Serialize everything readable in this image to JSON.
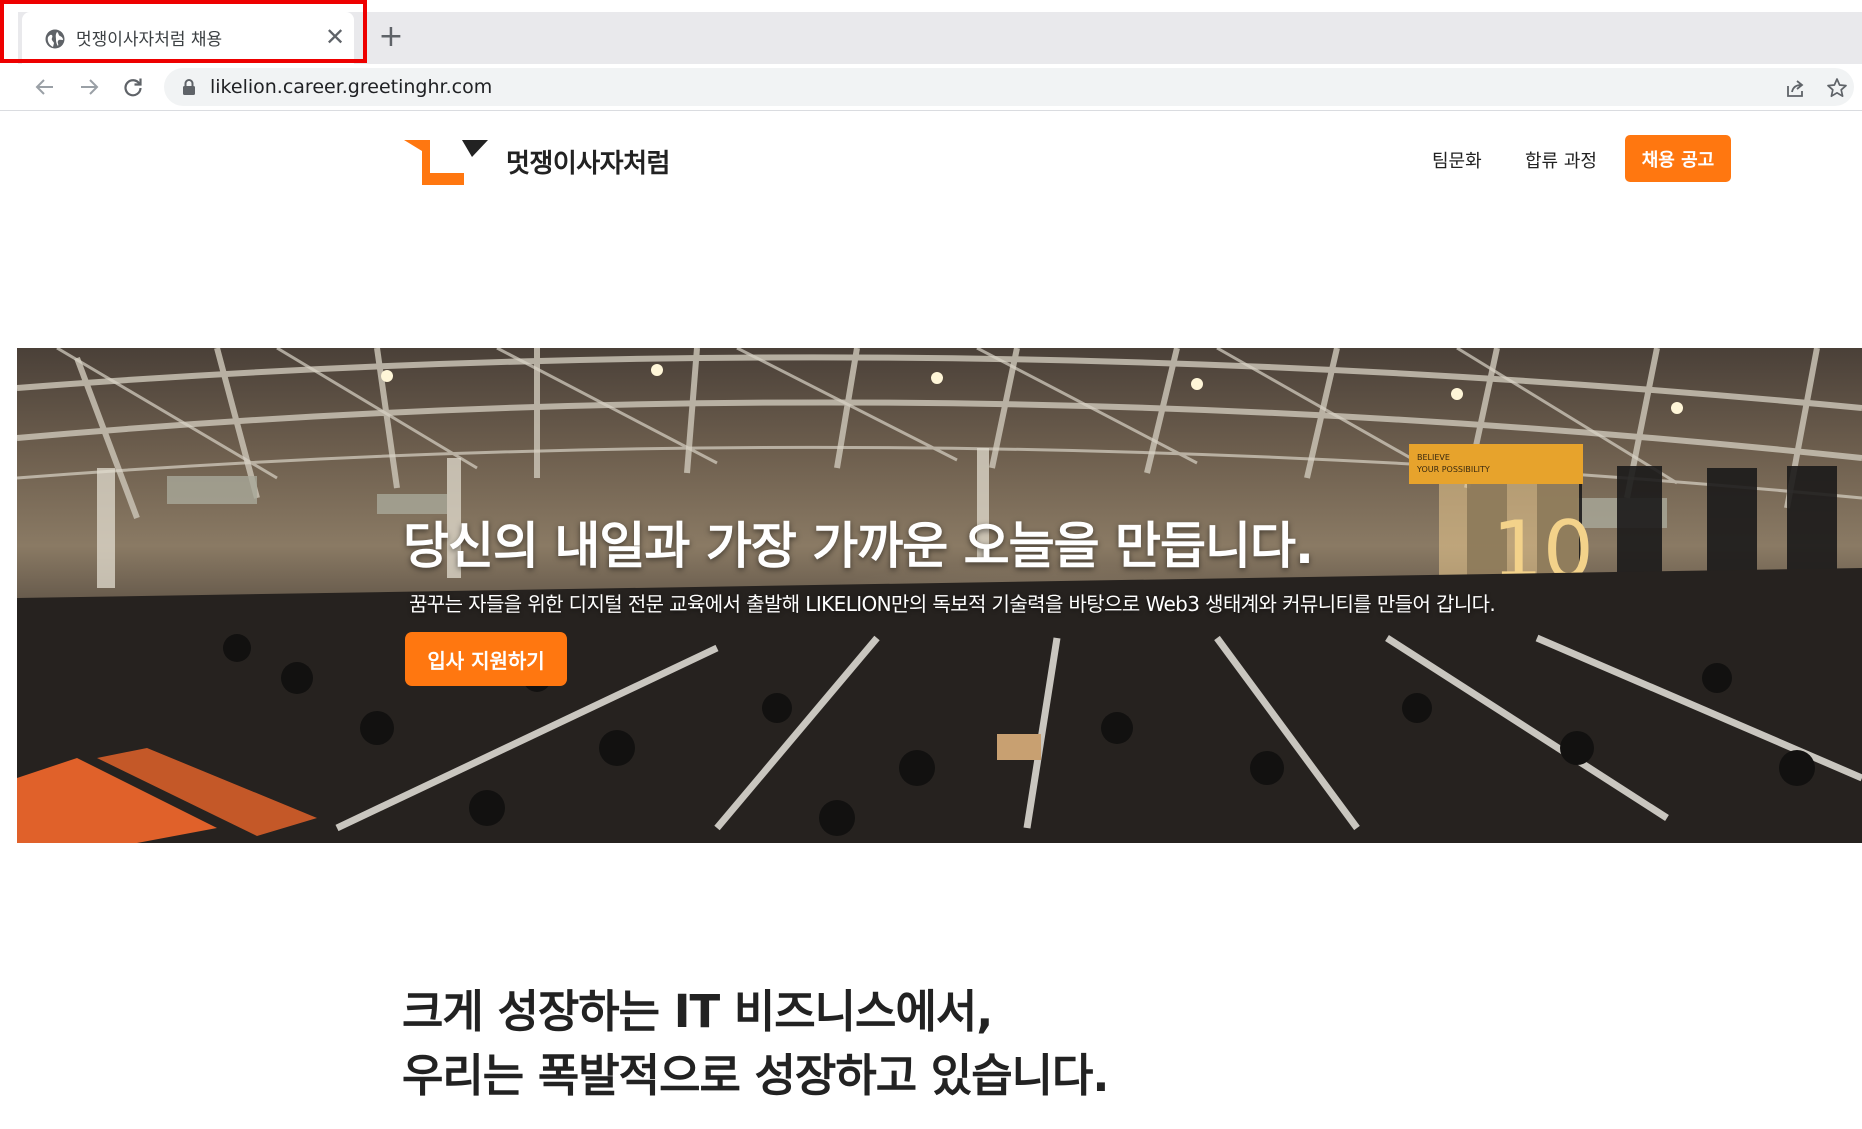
{
  "browser": {
    "tab": {
      "title": "멋쟁이사자처럼 채용",
      "close_glyph": "✕",
      "icon": "globe-icon"
    },
    "new_tab_glyph": "+",
    "toolbar": {
      "url": "likelion.career.greetinghr.com",
      "back_icon": "back-arrow-icon",
      "forward_icon": "forward-arrow-icon",
      "reload_icon": "reload-icon",
      "lock_icon": "lock-icon",
      "share_icon": "share-icon",
      "bookmark_icon": "star-icon"
    },
    "highlight_color": "#ee0000"
  },
  "site": {
    "brand": "멋쟁이사자처럼",
    "nav": [
      "팀문화",
      "합류 과정"
    ],
    "cta": "채용 공고",
    "accent": "#ff7710"
  },
  "hero": {
    "title": "당신의 내일과 가장 가까운 오늘을 만듭니다.",
    "subtitle": "꿈꾸는 자들을 위한 디지털 전문 교육에서 출발해 LIKELION만의 독보적 기술력을 바탕으로 Web3 생태계와 커뮤니티를 만들어 갑니다.",
    "button": "입사 지원하기",
    "banner": {
      "line1": "BELIEVE",
      "line2": "YOUR POSSIBILITY",
      "number": "10"
    }
  },
  "section": {
    "headline": [
      "크게 성장하는 IT 비즈니스에서,",
      "우리는 폭발적으로 성장하고 있습니다."
    ]
  }
}
